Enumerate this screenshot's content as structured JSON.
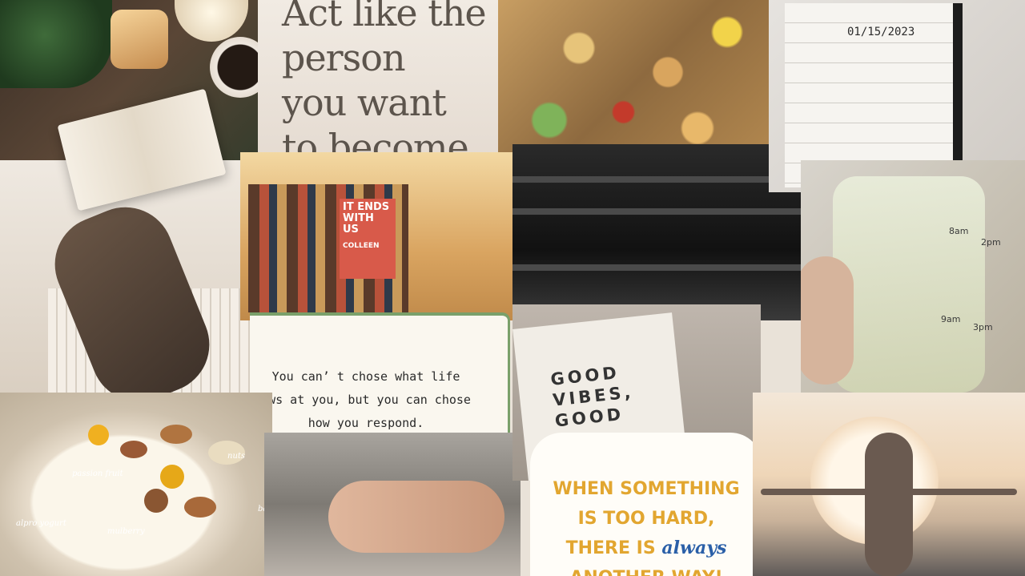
{
  "quote_top": {
    "lines": [
      "Act like the",
      "person",
      "you want",
      "to become."
    ]
  },
  "notebook": {
    "date": "01/15/2023"
  },
  "bottle_marks": {
    "m1": "8am",
    "m2": "2pm",
    "m3": "9am",
    "m4": "3pm"
  },
  "book_cover": {
    "title": "IT ENDS WITH US",
    "author": "COLLEEN"
  },
  "note": {
    "line1": "You can’ t chose what life",
    "line2": "ows at you, but you can chose",
    "line3": "how you respond."
  },
  "yogurt_labels": {
    "a": "passion fruit",
    "b": "nuts",
    "c": "alpro yogurt",
    "d": "mulberry",
    "e": "banana"
  },
  "good_vibes": {
    "l1": "GOOD",
    "l2": "VIBES,",
    "l3": "GOOD"
  },
  "sticker": {
    "l1": "WHEN SOMETHING",
    "l2": "IS TOO HARD,",
    "l3a": "THERE IS",
    "l3b": "always",
    "l4": "ANOTHER WAY!"
  }
}
